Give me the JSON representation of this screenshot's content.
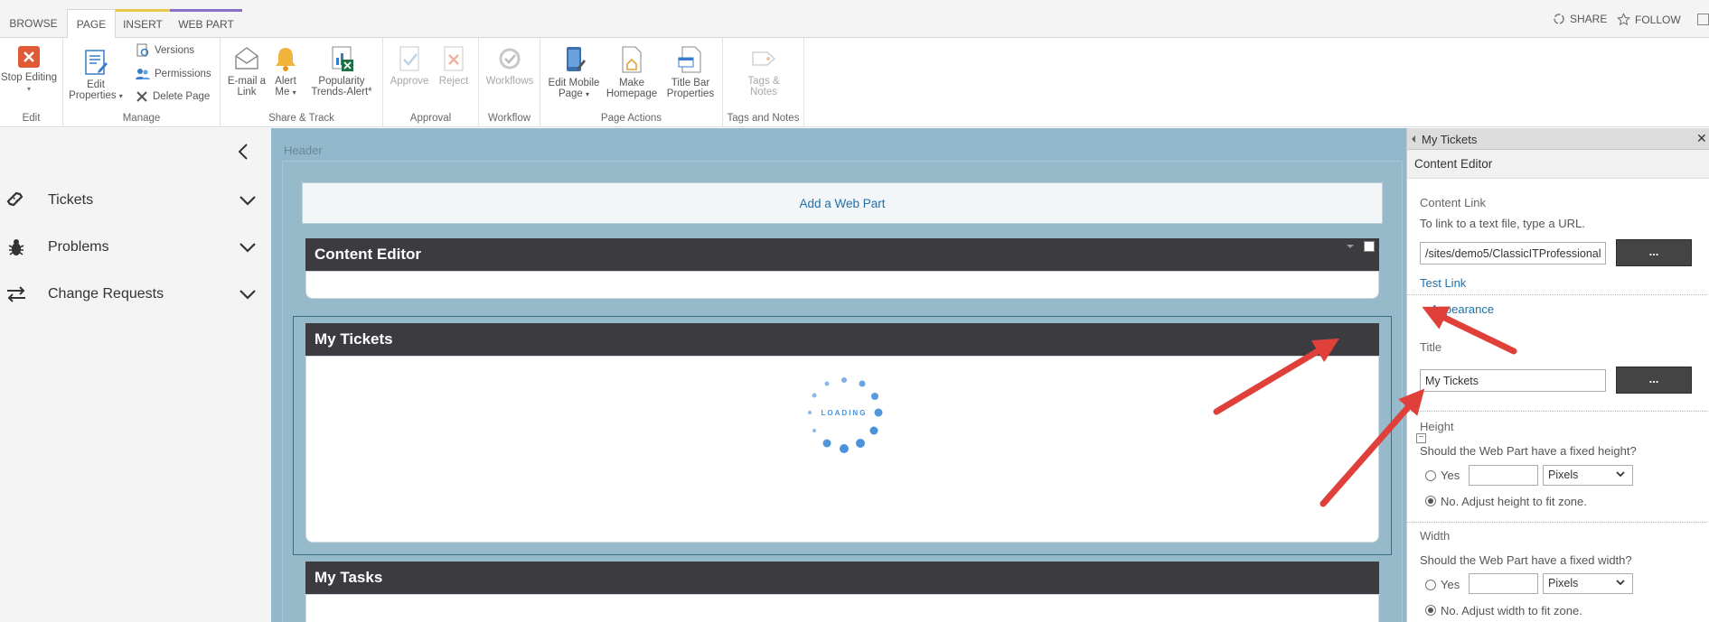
{
  "ribbon_tabs": [
    "BROWSE",
    "PAGE",
    "INSERT",
    "WEB PART"
  ],
  "top_right": {
    "share": "SHARE",
    "follow": "FOLLOW"
  },
  "ribbon": {
    "edit": {
      "stop_editing": "Stop Editing",
      "group": "Edit"
    },
    "manage": {
      "edit_properties_1": "Edit",
      "edit_properties_2": "Properties",
      "versions": "Versions",
      "permissions": "Permissions",
      "delete_page": "Delete Page",
      "group": "Manage"
    },
    "share_track": {
      "email_1": "E-mail a",
      "email_2": "Link",
      "alert_1": "Alert",
      "alert_2": "Me",
      "pop_1": "Popularity",
      "pop_2": "Trends-Alert*",
      "group": "Share & Track"
    },
    "approval": {
      "approve": "Approve",
      "reject": "Reject",
      "group": "Approval"
    },
    "workflow": {
      "workflows": "Workflows",
      "group": "Workflow"
    },
    "page_actions": {
      "mobile_1": "Edit Mobile",
      "mobile_2": "Page",
      "home_1": "Make",
      "home_2": "Homepage",
      "titlebar_1": "Title Bar",
      "titlebar_2": "Properties",
      "group": "Page Actions"
    },
    "tags": {
      "tags_1": "Tags &",
      "tags_2": "Notes",
      "group": "Tags and Notes"
    }
  },
  "leftnav": {
    "items": [
      {
        "label": "Tickets",
        "icon": "ticket-icon"
      },
      {
        "label": "Problems",
        "icon": "bug-icon"
      },
      {
        "label": "Change Requests",
        "icon": "swap-arrows-icon"
      }
    ]
  },
  "main": {
    "header_label": "Header",
    "add_web_part": "Add a Web Part",
    "webparts": [
      {
        "title": "Content Editor"
      },
      {
        "title": "My Tickets",
        "loading": "LOADING"
      },
      {
        "title": "My Tasks"
      }
    ]
  },
  "toolpane": {
    "title": "My Tickets",
    "subtitle": "Content Editor",
    "content_link_label": "Content Link",
    "content_link_help": "To link to a text file, type a URL.",
    "content_link_value": "/sites/demo5/ClassicITProfessional",
    "dots": "...",
    "test_link": "Test Link",
    "appearance": "Appearance",
    "title_label": "Title",
    "title_value": "My Tickets",
    "height_label": "Height",
    "height_question": "Should the Web Part have a fixed height?",
    "yes": "Yes",
    "pixels": "Pixels",
    "height_no": "No. Adjust height to fit zone.",
    "width_label": "Width",
    "width_question": "Should the Web Part have a fixed width?",
    "width_no": "No. Adjust width to fit zone."
  },
  "colors": {
    "accent": "#1e6fa6",
    "arrow": "#e0403a",
    "zone": "#93b8cb"
  }
}
